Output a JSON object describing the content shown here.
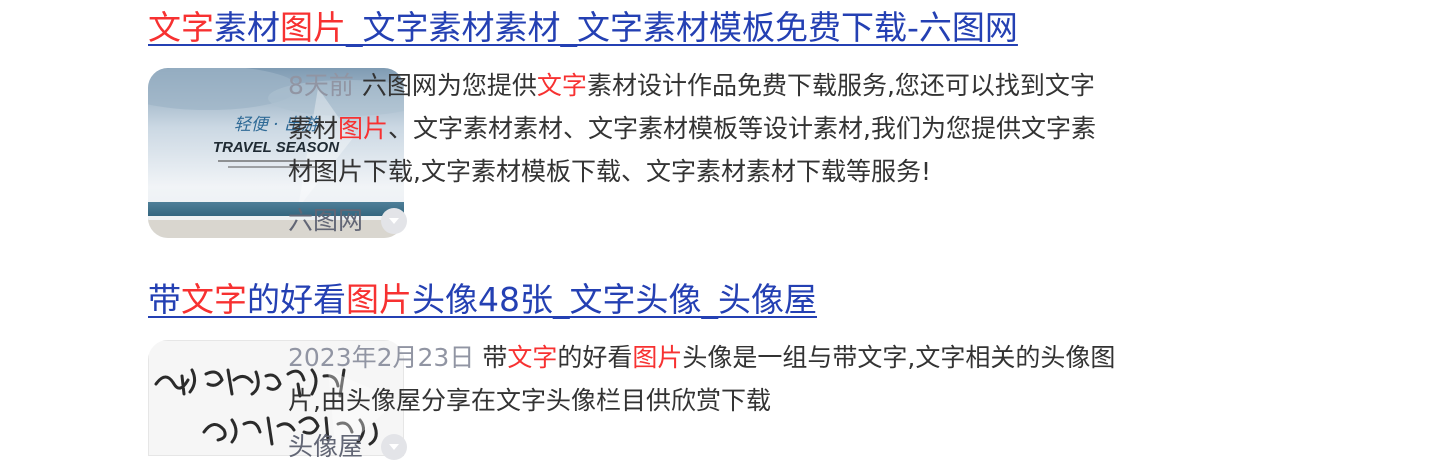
{
  "results": [
    {
      "title_parts": [
        {
          "text": "文字",
          "hl": true
        },
        {
          "text": "素材",
          "hl": false
        },
        {
          "text": "图片",
          "hl": true
        },
        {
          "text": "_文字素材素材_文字素材模板免费下载-六图网",
          "hl": false
        }
      ],
      "thumbnail": {
        "caption_cn": "轻便 · 出游",
        "caption_en": "TRAVEL SEASON",
        "icon": "travel-poster-image"
      },
      "date": "8天前",
      "snippet_parts": [
        {
          "text": "六图网为您提供",
          "hl": false
        },
        {
          "text": "文字",
          "hl": true
        },
        {
          "text": "素材设计作品免费下载服务,您还可以找到文字素材",
          "hl": false
        },
        {
          "text": "图片",
          "hl": true
        },
        {
          "text": "、文字素材素材、文字素材模板等设计素材,我们为您提供文字素材图片下载,文字素材模板下载、文字素材素材下载等服务!",
          "hl": false
        }
      ],
      "source": "六图网",
      "more_icon": "chevron-down-circle-icon"
    },
    {
      "title_parts": [
        {
          "text": "带",
          "hl": false
        },
        {
          "text": "文字",
          "hl": true
        },
        {
          "text": "的好看",
          "hl": false
        },
        {
          "text": "图片",
          "hl": true
        },
        {
          "text": "头像48张_文字头像_头像屋",
          "hl": false
        }
      ],
      "thumbnail": {
        "icon": "calligraphy-text-image"
      },
      "date": "2023年2月23日",
      "snippet_parts": [
        {
          "text": "带",
          "hl": false
        },
        {
          "text": "文字",
          "hl": true
        },
        {
          "text": "的好看",
          "hl": false
        },
        {
          "text": "图片",
          "hl": true
        },
        {
          "text": "头像是一组与带文字,文字相关的头像图片,由头像屋分享在文字头像栏目供欣赏下载",
          "hl": false
        }
      ],
      "source": "头像屋",
      "more_icon": "chevron-down-circle-icon"
    }
  ],
  "colors": {
    "title_link": "#2440b3",
    "highlight": "#f73131",
    "snippet_text": "#333333",
    "date_text": "#9195a3",
    "source_text": "#626675"
  }
}
